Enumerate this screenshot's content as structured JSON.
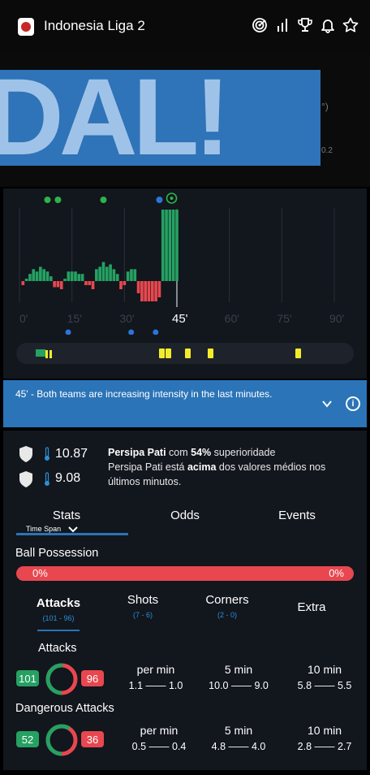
{
  "header": {
    "title": "Indonesia Liga 2",
    "icons": [
      "radar-icon",
      "bar-chart-icon",
      "trophy-icon",
      "bell-icon",
      "star-icon"
    ]
  },
  "hero": {
    "goal_text": "DAL!",
    "faint_right_1": "°)",
    "faint_right_2": "0.2"
  },
  "chart": {
    "x_ticks": [
      "0'",
      "15'",
      "30'",
      "45'",
      "60'",
      "75'",
      "90'"
    ],
    "current_minute": "45'",
    "top_event_icons": [
      "substitution-icon",
      "substitution-icon",
      "substitution-icon",
      "blue-dot-icon",
      "goal-ball-icon"
    ],
    "colors": {
      "home": "#25a162",
      "away": "#e8474f",
      "card": "#f4ec2b",
      "blue": "#2b74d8"
    }
  },
  "chart_data": {
    "type": "bar",
    "description_series": [
      {
        "name": "home",
        "values": [
          0,
          0,
          0,
          0,
          0,
          0,
          0,
          0,
          0,
          0,
          0,
          0,
          0,
          0,
          0,
          0,
          0,
          0,
          0,
          0
        ]
      },
      {
        "name": "away",
        "values": [
          0,
          0,
          0,
          0,
          0,
          0,
          0,
          0,
          0,
          0,
          0,
          0,
          0,
          0,
          0,
          0,
          0,
          0,
          0,
          0
        ]
      }
    ],
    "minutes": [
      1,
      2,
      3,
      4,
      5,
      6,
      7,
      8,
      9,
      10,
      11,
      12,
      13,
      14,
      15,
      16,
      17,
      18,
      19,
      20,
      21,
      22,
      23,
      24,
      25,
      26,
      27,
      28,
      29,
      30,
      31,
      32,
      33,
      34,
      35,
      36,
      37,
      38,
      39,
      40,
      41,
      42,
      43,
      44,
      45
    ],
    "values": [
      -2,
      1,
      3,
      5,
      4,
      6,
      5,
      4,
      2,
      -3,
      -3,
      -4,
      1,
      4,
      4,
      4,
      3,
      3,
      -2,
      -2,
      -4,
      5,
      6,
      8,
      6,
      7,
      5,
      3,
      -4,
      -2,
      4,
      5,
      5,
      -6,
      -10,
      -10,
      -10,
      -10,
      -10,
      -8,
      30,
      30,
      30,
      30,
      30
    ],
    "xlim": [
      0,
      90
    ],
    "ylim": [
      -12,
      30
    ]
  },
  "info": {
    "message": "45' - Both teams are increasing intensity in the last minutes."
  },
  "pressure": {
    "home_value": "10.87",
    "away_value": "9.08",
    "team": "Persipa Pati",
    "connector": " com ",
    "percent": "54%",
    "sup_word": " superioridade",
    "line2_team": "Persipa Pati",
    "line2_mid": " está ",
    "line2_bold": "acima",
    "line2_rest": " dos valores médios nos",
    "line3": "últimos minutos."
  },
  "tabs": {
    "stats": "Stats",
    "odds": "Odds",
    "events": "Events",
    "time_span": "Time Span"
  },
  "possession": {
    "label": "Ball Possession",
    "home": "0%",
    "away": "0%"
  },
  "subtabs": [
    {
      "label": "Attacks",
      "sub": "(101 - 96)"
    },
    {
      "label": "Shots",
      "sub": "(7 - 6)"
    },
    {
      "label": "Corners",
      "sub": "(2 - 0)"
    },
    {
      "label": "Extra",
      "sub": ""
    }
  ],
  "attacks": {
    "title": "Attacks",
    "home": "101",
    "away": "96",
    "home_fraction": 0.513,
    "per_min_label": "per min",
    "per_min": "1.1 —— 1.0",
    "five_label": "5 min",
    "five": "10.0 —— 9.0",
    "ten_label": "10 min",
    "ten": "5.8 —— 5.5"
  },
  "dangerous": {
    "title": "Dangerous Attacks",
    "home": "52",
    "away": "36",
    "home_fraction": 0.59,
    "per_min_label": "per min",
    "per_min": "0.5 —— 0.4",
    "five_label": "5 min",
    "five": "4.8 —— 4.0",
    "ten_label": "10 min",
    "ten": "2.8 —— 2.7"
  }
}
